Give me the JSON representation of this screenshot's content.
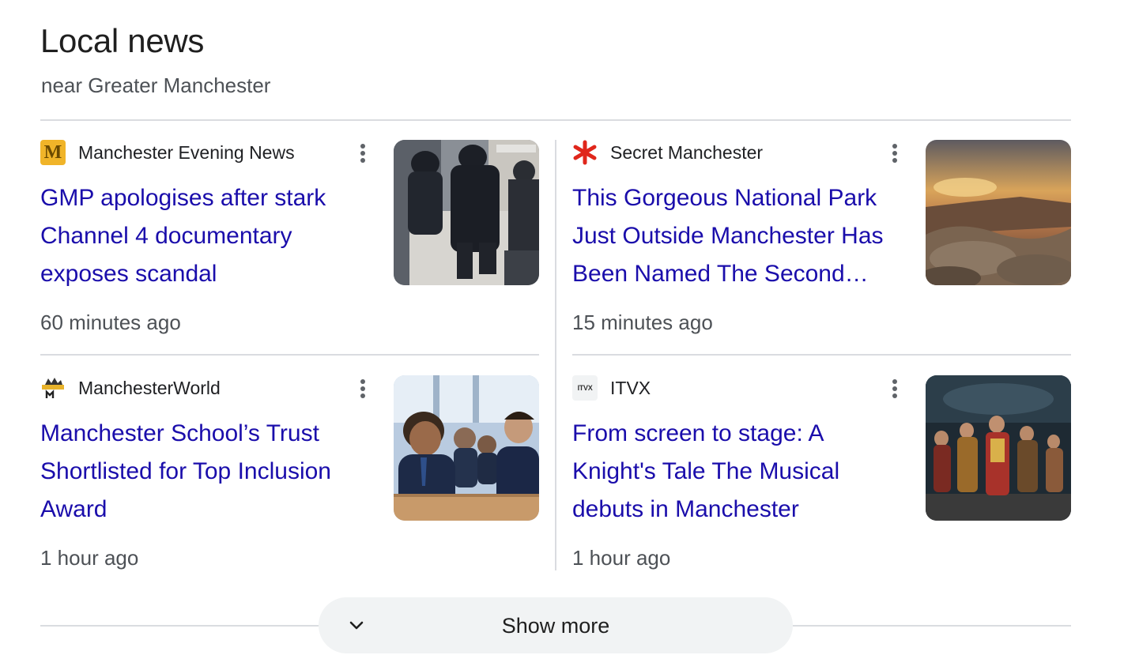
{
  "section": {
    "title": "Local news",
    "subtitle": "near Greater Manchester"
  },
  "articles": [
    {
      "source": "Manchester Evening News",
      "source_icon": "men-logo-icon",
      "headline": "GMP apologises after stark Channel 4 documentary exposes scandal",
      "time": "60 minutes ago",
      "thumbnail": "police-officers-photo"
    },
    {
      "source": "Secret Manchester",
      "source_icon": "secret-manchester-asterisk-icon",
      "headline": "This Gorgeous National Park Just Outside Manchester Has Been Named The Second…",
      "time": "15 minutes ago",
      "thumbnail": "national-park-sunset-photo"
    },
    {
      "source": "ManchesterWorld",
      "source_icon": "manchesterworld-logo-icon",
      "headline": "Manchester School’s Trust Shortlisted for Top Inclusion Award",
      "time": "1 hour ago",
      "thumbnail": "school-students-photo"
    },
    {
      "source": "ITVX",
      "source_icon": "itvx-logo-icon",
      "headline": "From screen to stage: A Knight's Tale The Musical debuts in Manchester",
      "time": "1 hour ago",
      "thumbnail": "musical-stage-photo"
    }
  ],
  "icon_texts": {
    "men": "M",
    "itvx": "ITVX"
  },
  "show_more": {
    "label": "Show more",
    "icon": "chevron-down-icon"
  },
  "colors": {
    "link": "#1a0dab",
    "meta": "#4d5156",
    "divider": "#dadce0",
    "button_bg": "#f1f3f4"
  }
}
